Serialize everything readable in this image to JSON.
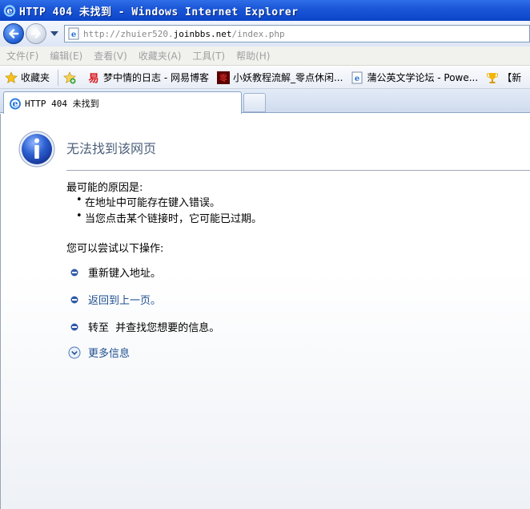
{
  "window": {
    "title": "HTTP 404 未找到 - Windows Internet Explorer"
  },
  "address": {
    "url_prefix": "http://zhuier520.",
    "url_domain": "joinbbs.net",
    "url_suffix": "/index.php"
  },
  "menu": [
    "文件(F)",
    "编辑(E)",
    "查看(V)",
    "收藏夹(A)",
    "工具(T)",
    "帮助(H)"
  ],
  "favorites": {
    "label": "收藏夹",
    "items": [
      {
        "label": "梦中情的日志 - 网易博客",
        "icon": "netease-icon"
      },
      {
        "label": "小妖教程流解_零点休闲...",
        "icon": "site-icon"
      },
      {
        "label": "蒲公英文学论坛 - Powe...",
        "icon": "ie-page-icon"
      },
      {
        "label": "【新",
        "icon": "trophy-icon"
      }
    ]
  },
  "tab": {
    "label": "HTTP 404 未找到"
  },
  "error_page": {
    "title": "无法找到该网页",
    "causes_title": "最可能的原因是:",
    "causes": [
      "在地址中可能存在键入错误。",
      "当您点击某个链接时，它可能已过期。"
    ],
    "try_title": "您可以尝试以下操作:",
    "actions": [
      {
        "label": "重新键入地址。",
        "link": false
      },
      {
        "label": "返回到上一页。",
        "link": true
      },
      {
        "label": "转至  并查找您想要的信息。",
        "link": false
      }
    ],
    "more_info": "更多信息"
  },
  "colors": {
    "titlebar": "#0b45c8",
    "link": "#1f4f8f",
    "title_text": "#4c607a"
  }
}
